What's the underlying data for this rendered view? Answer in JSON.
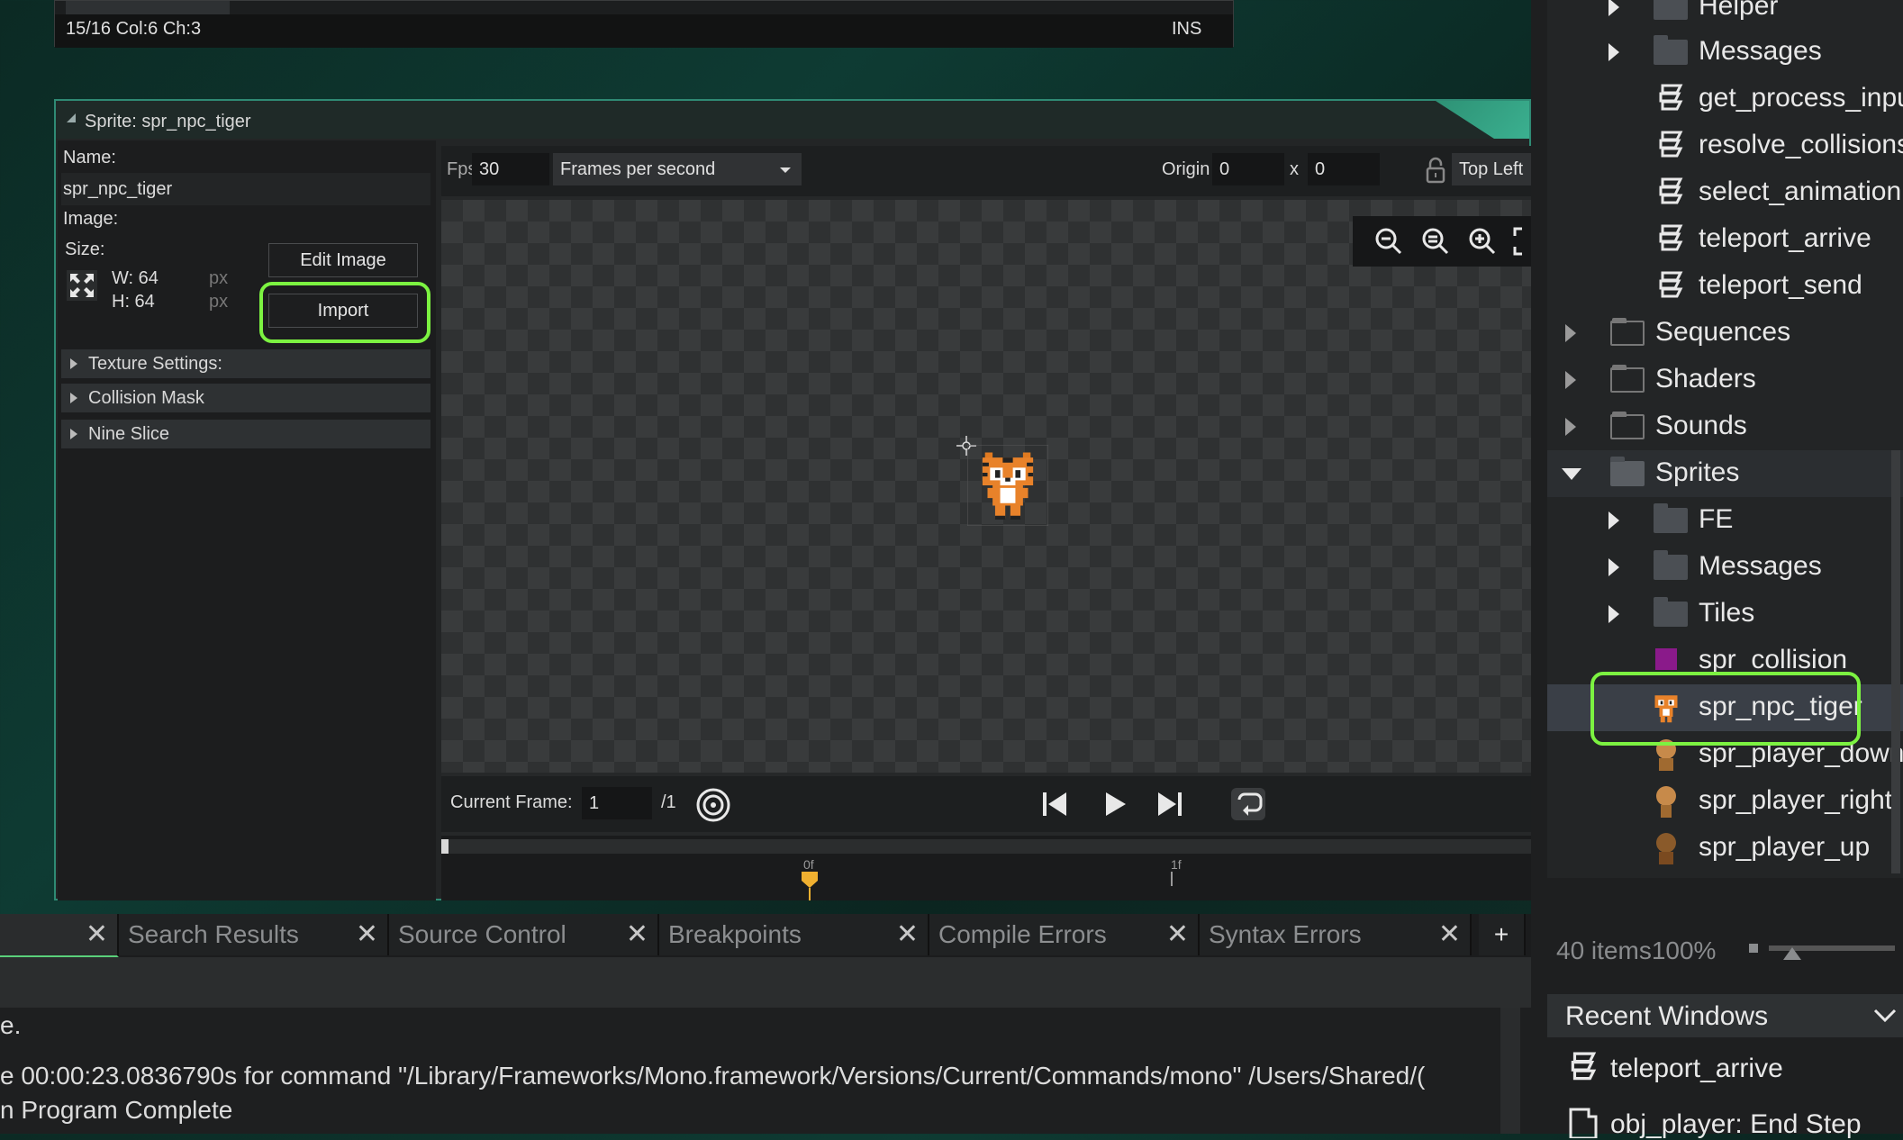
{
  "code_editor": {
    "status_position": "15/16 Col:6 Ch:3",
    "status_mode": "INS"
  },
  "sprite_editor": {
    "title": "Sprite: spr_npc_tiger",
    "name_label": "Name:",
    "name_value": "spr_npc_tiger",
    "image_label": "Image:",
    "size_label": "Size:",
    "width": "W: 64",
    "height": "H: 64",
    "unit": "px",
    "edit_image_button": "Edit Image",
    "import_button": "Import",
    "sections": [
      "Texture Settings:",
      "Collision Mask",
      "Nine Slice"
    ],
    "fps_label": "Fps",
    "fps_value": "30",
    "fps_mode": "Frames per second",
    "origin_label": "Origin",
    "origin_x": "0",
    "origin_x_sep": "x",
    "origin_y": "0",
    "origin_preset": "Top Left",
    "current_frame_label": "Current Frame:",
    "current_frame": "1",
    "frame_total": "/1",
    "timeline_marks": [
      "0f",
      "1f"
    ]
  },
  "bottom_tabs": [
    "Search Results",
    "Source Control",
    "Breakpoints",
    "Compile Errors",
    "Syntax Errors"
  ],
  "add_tab": "+",
  "output_lines": [
    "e.",
    "e 00:00:23.0836790s for command \"/Library/Frameworks/Mono.framework/Versions/Current/Commands/mono\" /Users/Shared/(",
    "n Program Complete"
  ],
  "asset_browser": {
    "items": [
      {
        "label": "Helper",
        "kind": "folder"
      },
      {
        "label": "Messages",
        "kind": "folder"
      },
      {
        "label": "get_process_input",
        "kind": "script"
      },
      {
        "label": "resolve_collisions",
        "kind": "script"
      },
      {
        "label": "select_animation",
        "kind": "script"
      },
      {
        "label": "teleport_arrive",
        "kind": "script"
      },
      {
        "label": "teleport_send",
        "kind": "script"
      },
      {
        "label": "Sequences",
        "kind": "group"
      },
      {
        "label": "Shaders",
        "kind": "group"
      },
      {
        "label": "Sounds",
        "kind": "group"
      },
      {
        "label": "Sprites",
        "kind": "group-open"
      },
      {
        "label": "FE",
        "kind": "folder"
      },
      {
        "label": "Messages",
        "kind": "folder"
      },
      {
        "label": "Tiles",
        "kind": "folder"
      },
      {
        "label": "spr_collision",
        "kind": "sprite"
      },
      {
        "label": "spr_npc_tiger",
        "kind": "sprite",
        "selected": true
      },
      {
        "label": "spr_player_down",
        "kind": "sprite"
      },
      {
        "label": "spr_player_right",
        "kind": "sprite"
      },
      {
        "label": "spr_player_up",
        "kind": "sprite"
      }
    ],
    "status": "40 items100%",
    "recent_windows_label": "Recent Windows",
    "recent_items": [
      "teleport_arrive",
      "obj_player: End Step"
    ]
  },
  "colors": {
    "highlight": "#7cf241",
    "accent": "#2f8a74",
    "origin_marker": "#f0b030"
  }
}
